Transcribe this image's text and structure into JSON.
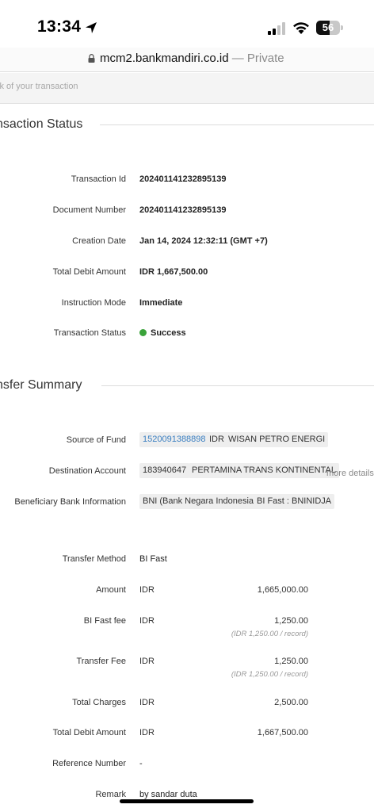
{
  "status_bar": {
    "time": "13:34",
    "battery": "56",
    "battery_level": 0.56
  },
  "url_bar": {
    "domain": "mcm2.bankmandiri.co.id",
    "private_label": "— Private"
  },
  "search": {
    "placeholder": "ck of your transaction"
  },
  "transaction_status": {
    "title": "nsaction Status",
    "rows": [
      {
        "label": "Transaction Id",
        "value": "202401141232895139"
      },
      {
        "label": "Document Number",
        "value": "202401141232895139"
      },
      {
        "label": "Creation Date",
        "value": "Jan 14, 2024 12:32:11 (GMT +7)"
      },
      {
        "label": "Total Debit Amount",
        "value": "IDR 1,667,500.00"
      },
      {
        "label": "Instruction Mode",
        "value": "Immediate"
      },
      {
        "label": "Transaction Status",
        "value": "Success"
      }
    ],
    "success_color": "#3aa33a"
  },
  "transfer_summary": {
    "title": "nsfer Summary",
    "source_of_fund": {
      "label": "Source of Fund",
      "account": "1520091388898",
      "currency": "IDR",
      "name": "WISAN PETRO ENERGI"
    },
    "destination_account": {
      "label": "Destination Account",
      "account": "183940647",
      "name": "PERTAMINA TRANS KONTINENTAL",
      "more": "more details"
    },
    "beneficiary_bank": {
      "label": "Beneficiary Bank Information",
      "bank": "BNI (Bank Negara Indonesia)",
      "code": "BI Fast : BNINIDJA"
    },
    "transfer_method": {
      "label": "Transfer Method",
      "value": "BI Fast"
    },
    "amount": {
      "label": "Amount",
      "currency": "IDR",
      "value": "1,665,000.00"
    },
    "bi_fast_fee": {
      "label": "BI Fast fee",
      "currency": "IDR",
      "value": "1,250.00",
      "note": "(IDR 1,250.00 / record)"
    },
    "transfer_fee": {
      "label": "Transfer Fee",
      "currency": "IDR",
      "value": "1,250.00",
      "note": "(IDR 1,250.00 / record)"
    },
    "total_charges": {
      "label": "Total Charges",
      "currency": "IDR",
      "value": "2,500.00"
    },
    "total_debit": {
      "label": "Total Debit Amount",
      "currency": "IDR",
      "value": "1,667,500.00"
    },
    "reference_number": {
      "label": "Reference Number",
      "value": "-"
    },
    "remark": {
      "label": "Remark",
      "value": "by sandar duta"
    }
  },
  "link_color": "#3a7fc1"
}
